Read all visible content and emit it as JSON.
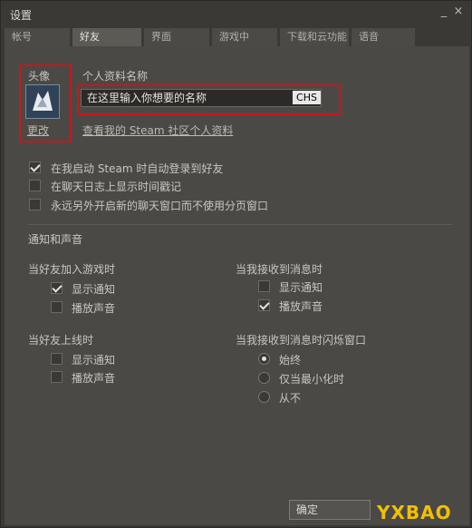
{
  "window": {
    "title": "设置"
  },
  "window_controls": {
    "minimize": "_",
    "close": "×"
  },
  "tabs": [
    {
      "label": "帐号"
    },
    {
      "label": "好友"
    },
    {
      "label": "界面"
    },
    {
      "label": "游戏中"
    },
    {
      "label": "下载和云功能"
    },
    {
      "label": "语音"
    }
  ],
  "profile": {
    "avatar_heading": "头像",
    "avatar_change_link": "更改",
    "name_heading": "个人资料名称",
    "name_input_value": "在这里输入你想要的名称",
    "ime_indicator": "CHS",
    "community_profile_link": "查看我的 Steam 社区个人资料"
  },
  "general_options": [
    {
      "label": "在我启动 Steam 时自动登录到好友",
      "checked": true
    },
    {
      "label": "在聊天日志上显示时间戳记",
      "checked": false
    },
    {
      "label": "永远另外开启新的聊天窗口而不使用分页窗口",
      "checked": false
    }
  ],
  "notifications": {
    "heading": "通知和声音",
    "friend_joins_game": {
      "heading": "当好友加入游戏时",
      "options": [
        {
          "label": "显示通知",
          "checked": true
        },
        {
          "label": "播放声音",
          "checked": false
        }
      ]
    },
    "receive_message": {
      "heading": "当我接收到消息时",
      "options": [
        {
          "label": "显示通知",
          "checked": false
        },
        {
          "label": "播放声音",
          "checked": true
        }
      ]
    },
    "friend_online": {
      "heading": "当好友上线时",
      "options": [
        {
          "label": "显示通知",
          "checked": false
        },
        {
          "label": "播放声音",
          "checked": false
        }
      ]
    },
    "flash_window": {
      "heading": "当我接收到消息时闪烁窗口",
      "options": [
        {
          "label": "始终",
          "selected": true
        },
        {
          "label": "仅当最小化时",
          "selected": false
        },
        {
          "label": "从不",
          "selected": false
        }
      ]
    }
  },
  "footer": {
    "ok_label": "确定",
    "watermark": "YXBAO"
  },
  "colors": {
    "highlight_box": "#c8161b",
    "watermark": "#f2c000"
  }
}
